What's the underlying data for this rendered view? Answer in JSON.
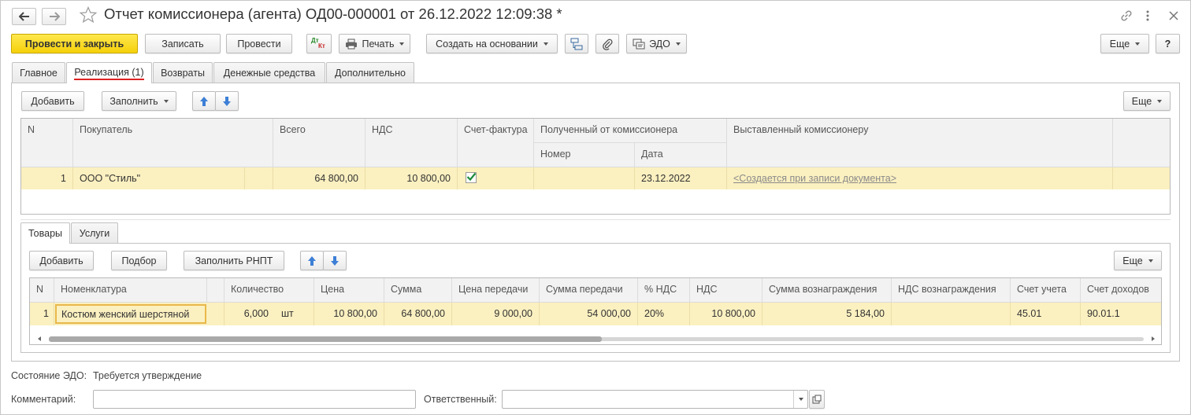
{
  "window": {
    "title": "Отчет комиссионера (агента) ОД00-000001 от 26.12.2022 12:09:38 *"
  },
  "toolbar": {
    "post_close": "Провести и закрыть",
    "save": "Записать",
    "post": "Провести",
    "dtkt_dt": "Дт",
    "dtkt_kt": "Кт",
    "print": "Печать",
    "create_based": "Создать на основании",
    "edo": "ЭДО",
    "more": "Еще",
    "help": "?"
  },
  "tabs": [
    "Главное",
    "Реализация (1)",
    "Возвраты",
    "Денежные средства",
    "Дополнительно"
  ],
  "upper": {
    "add": "Добавить",
    "fill": "Заполнить",
    "more": "Еще",
    "headers": {
      "n": "N",
      "buyer": "Покупатель",
      "total": "Всего",
      "vat": "НДС",
      "invoice": "Счет-фактура",
      "received": "Полученный от комиссионера",
      "number": "Номер",
      "date": "Дата",
      "issued": "Выставленный комиссионеру"
    },
    "rows": [
      {
        "n": "1",
        "buyer": "ООО \"Стиль\"",
        "total": "64 800,00",
        "vat": "10 800,00",
        "invoice_checked": true,
        "number": "",
        "date": "23.12.2022",
        "issued": "<Создается при записи документа>"
      }
    ]
  },
  "subtabs": [
    "Товары",
    "Услуги"
  ],
  "lower": {
    "add": "Добавить",
    "pick": "Подбор",
    "fill_rnpt": "Заполнить РНПТ",
    "more": "Еще",
    "headers": [
      "N",
      "Номенклатура",
      "Количество",
      "Цена",
      "Сумма",
      "Цена передачи",
      "Сумма передачи",
      "% НДС",
      "НДС",
      "Сумма вознаграждения",
      "НДС вознаграждения",
      "Счет учета",
      "Счет доходов"
    ],
    "rows": [
      {
        "n": "1",
        "item": "Костюм женский шерстяной",
        "qty": "6,000",
        "unit": "шт",
        "price": "10 800,00",
        "sum": "64 800,00",
        "transfer_price": "9 000,00",
        "transfer_sum": "54 000,00",
        "vat_rate": "20%",
        "vat": "10 800,00",
        "reward_sum": "5 184,00",
        "reward_vat": "",
        "account": "45.01",
        "income_account": "90.01.1"
      }
    ]
  },
  "footer": {
    "edo_state_label": "Состояние ЭДО:",
    "edo_state_value": "Требуется утверждение",
    "comment_label": "Комментарий:",
    "responsible_label": "Ответственный:"
  }
}
